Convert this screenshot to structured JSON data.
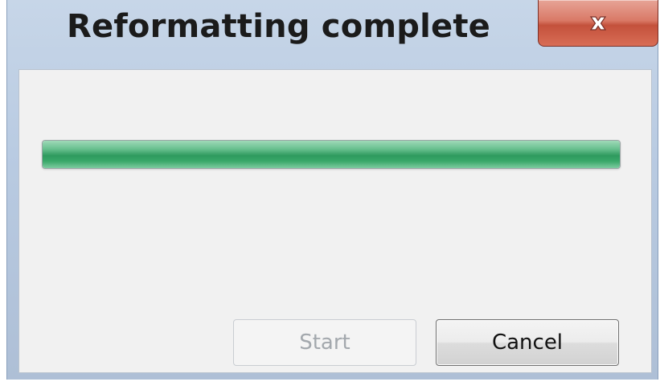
{
  "window": {
    "title": "Reformatting complete"
  },
  "icons": {
    "close": "close-icon"
  },
  "progress": {
    "percent": 100,
    "color": "#2e9a5e"
  },
  "buttons": {
    "start_label": "Start",
    "start_enabled": false,
    "cancel_label": "Cancel"
  },
  "colors": {
    "close_button": "#d97966",
    "frame": "#b9cbe2",
    "client_bg": "#f1f1f1"
  }
}
